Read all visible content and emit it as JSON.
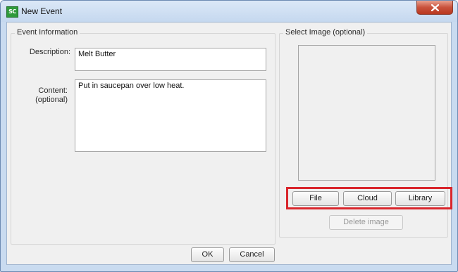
{
  "window": {
    "title": "New Event",
    "app_icon_text": "SC"
  },
  "event_info": {
    "title": "Event Information",
    "description_label": "Description:",
    "description_value": "Melt Butter",
    "content_label_line1": "Content:",
    "content_label_line2": "(optional)",
    "content_value": "Put in saucepan over low heat."
  },
  "image_panel": {
    "title": "Select Image (optional)",
    "file_label": "File",
    "cloud_label": "Cloud",
    "library_label": "Library",
    "delete_label": "Delete image"
  },
  "footer": {
    "ok_label": "OK",
    "cancel_label": "Cancel"
  },
  "colors": {
    "highlight": "#d9262c",
    "close_button": "#c9523c"
  }
}
